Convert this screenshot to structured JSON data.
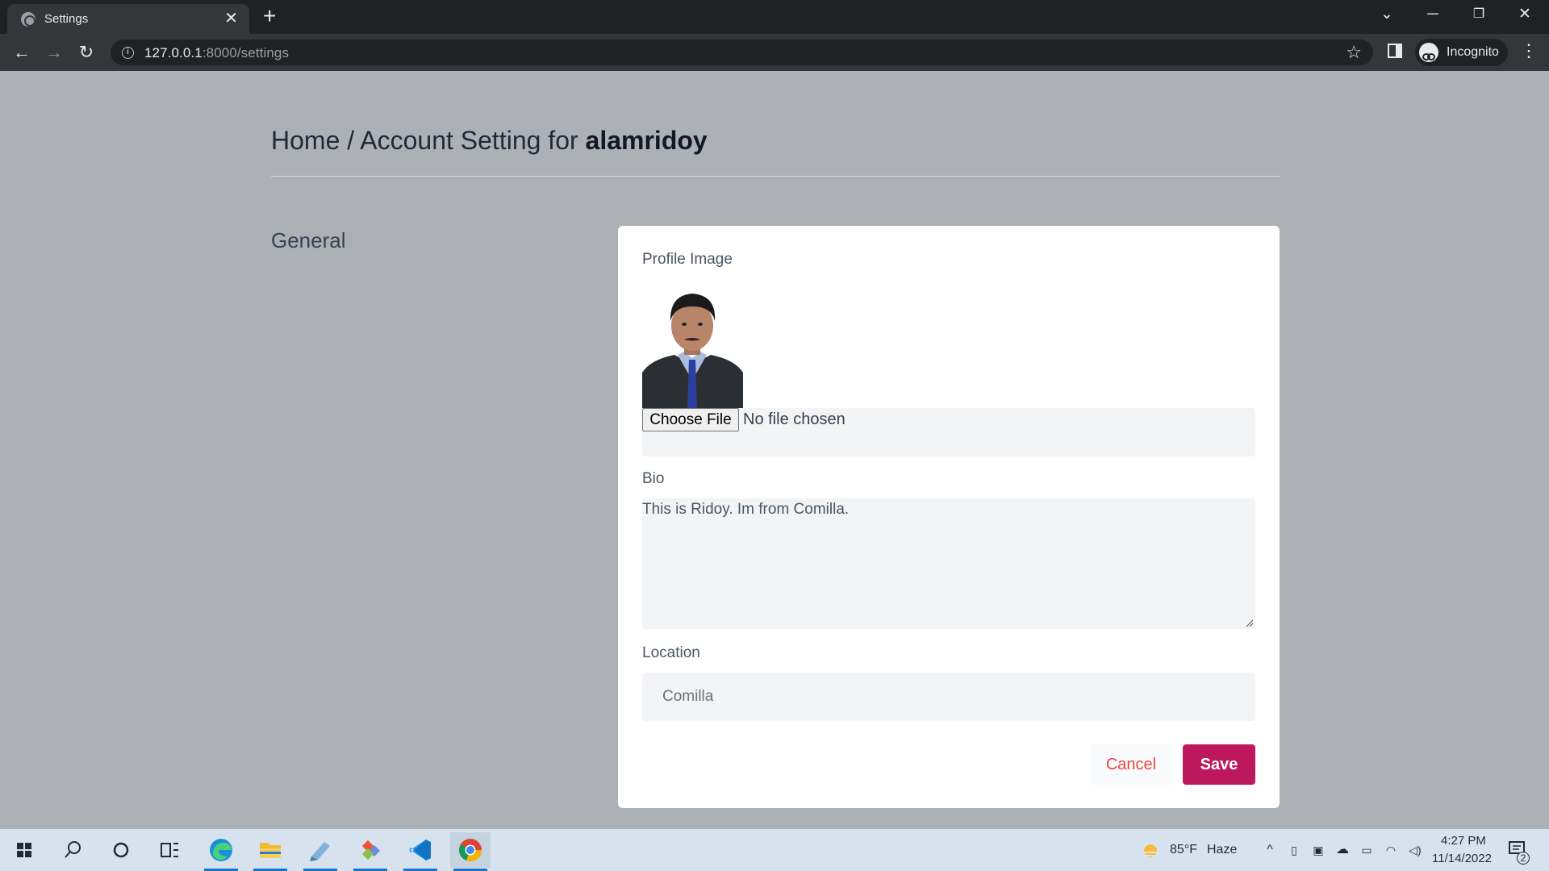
{
  "browser": {
    "tab_title": "Settings",
    "url_host": "127.0.0.1",
    "url_rest": ":8000/settings",
    "profile_label": "Incognito"
  },
  "page": {
    "breadcrumb_prefix": "Home / Account Setting for",
    "username": "alamridoy",
    "section_label": "General"
  },
  "form": {
    "profile_image_label": "Profile Image",
    "choose_file_label": "Choose File",
    "file_status": "No file chosen",
    "bio_label": "Bio",
    "bio_value": "This is Ridoy. Im from Comilla.",
    "location_label": "Location",
    "location_value": "Comilla",
    "cancel_label": "Cancel",
    "save_label": "Save"
  },
  "taskbar": {
    "weather_temp": "85°F",
    "weather_desc": "Haze",
    "time": "4:27 PM",
    "date": "11/14/2022",
    "notification_count": "2",
    "apps": [
      "start-icon",
      "search-icon",
      "cortana-icon",
      "task-view-icon",
      "edge-icon",
      "file-explorer-icon",
      "notepad-icon",
      "git-icon",
      "vscode-icon",
      "chrome-icon"
    ]
  },
  "colors": {
    "save_button": "#be185d",
    "cancel_text": "#ef4444",
    "page_background": "#adb0b5"
  }
}
